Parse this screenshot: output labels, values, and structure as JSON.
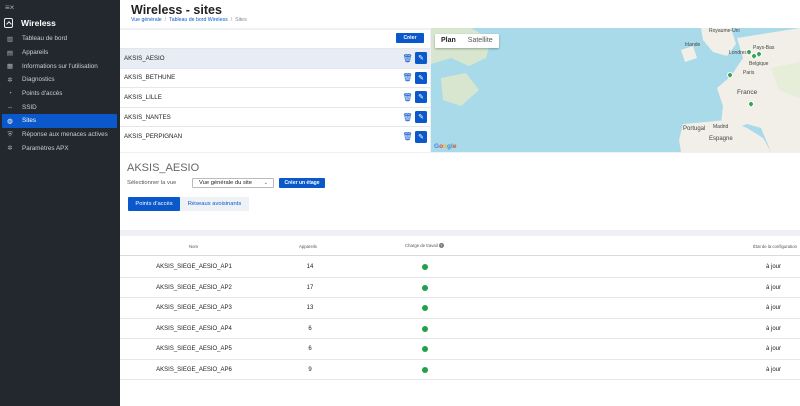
{
  "sidebar": {
    "app_name": "Wireless",
    "items": [
      {
        "label": "Tableau de bord",
        "icon": "▥",
        "active": false
      },
      {
        "label": "Appareils",
        "icon": "▤",
        "active": false
      },
      {
        "label": "Informations sur l'utilisation",
        "icon": "▦",
        "active": false
      },
      {
        "label": "Diagnostics",
        "icon": "✲",
        "active": false
      },
      {
        "label": "Points d'accès",
        "icon": "◔",
        "active": false
      },
      {
        "label": "SSID",
        "icon": "⇔",
        "active": false
      },
      {
        "label": "Sites",
        "icon": "◍",
        "active": true
      },
      {
        "label": "Réponse aux menaces actives",
        "icon": "⛨",
        "active": false
      },
      {
        "label": "Paramètres APX",
        "icon": "✲",
        "active": false
      }
    ]
  },
  "header": {
    "title": "Wireless - sites",
    "breadcrumb": [
      "Vue générale",
      "Tableau de bord Wireless",
      "Sites"
    ]
  },
  "sites": {
    "create_label": "Créer",
    "list": [
      "AKSIS_AESIO",
      "AKSIS_BETHUNE",
      "AKSIS_LILLE",
      "AKSIS_NANTES",
      "AKSIS_PERPIGNAN"
    ],
    "selected": "AKSIS_AESIO"
  },
  "map": {
    "tab_plan": "Plan",
    "tab_satellite": "Satellite",
    "labels": [
      "Royaume-Uni",
      "Irlande",
      "Londres",
      "Pays-Bas",
      "Belgique",
      "Paris",
      "France",
      "Portugal",
      "Madrid",
      "Espagne"
    ],
    "google": [
      "G",
      "o",
      "o",
      "g",
      "l",
      "e"
    ]
  },
  "detail": {
    "site_title": "AKSIS_AESIO",
    "view_label": "Sélectionner la vue",
    "view_value": "Vue générale du site",
    "create_floor_label": "Créer un étage",
    "tab_access_points": "Points d'accès",
    "tab_neighbor_networks": "Réseaux avoisinants"
  },
  "table": {
    "headers": {
      "name": "Nom",
      "devices": "Appareils",
      "load": "Charge de travail",
      "config": "État de la configuration"
    },
    "rows": [
      {
        "name": "AKSIS_SIEGE_AESIO_AP1",
        "devices": "14",
        "config": "à jour"
      },
      {
        "name": "AKSIS_SIEGE_AESIO_AP2",
        "devices": "17",
        "config": "à jour"
      },
      {
        "name": "AKSIS_SIEGE_AESIO_AP3",
        "devices": "13",
        "config": "à jour"
      },
      {
        "name": "AKSIS_SIEGE_AESIO_AP4",
        "devices": "6",
        "config": "à jour"
      },
      {
        "name": "AKSIS_SIEGE_AESIO_AP5",
        "devices": "6",
        "config": "à jour"
      },
      {
        "name": "AKSIS_SIEGE_AESIO_AP6",
        "devices": "9",
        "config": "à jour"
      }
    ],
    "status_color": "#1fa24a"
  },
  "colors": {
    "accent": "#0a58ca",
    "sidebar_bg": "#23282e"
  }
}
